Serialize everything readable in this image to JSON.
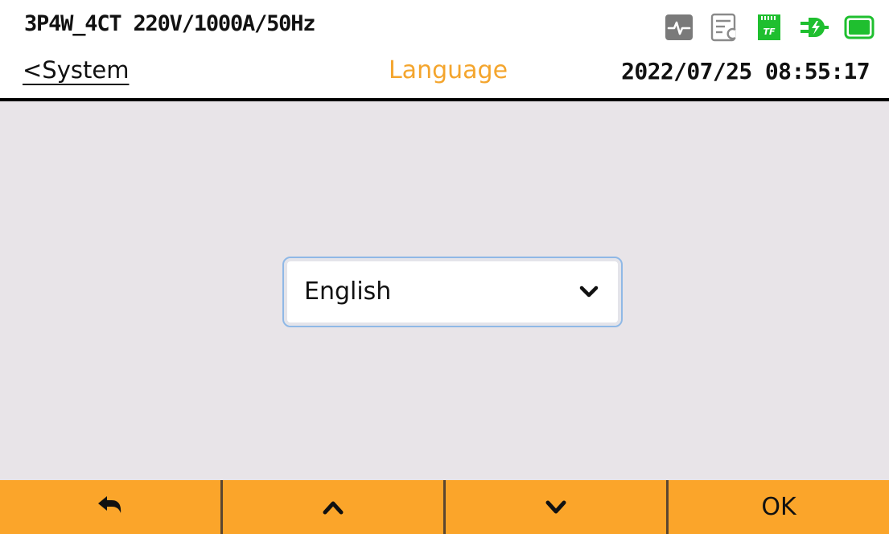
{
  "header": {
    "config": "3P4W_4CT 220V/1000A/50Hz",
    "back_label": "<System",
    "title": "Language",
    "datetime": "2022/07/25 08:55:17",
    "status_icons": [
      "waveform-icon",
      "log-icon",
      "sd-card-icon",
      "power-plug-icon",
      "battery-icon"
    ],
    "sd_card_text": "TF"
  },
  "language_select": {
    "value": "English"
  },
  "softkeys": [
    {
      "name": "back-return-icon",
      "label": ""
    },
    {
      "name": "up-arrow-icon",
      "label": ""
    },
    {
      "name": "down-arrow-icon",
      "label": ""
    },
    {
      "name": "ok",
      "label": "OK"
    }
  ],
  "colors": {
    "accent": "#fba52a",
    "title": "#f4a52d",
    "status_green": "#1fbf2f",
    "status_gray": "#7a7a7a",
    "select_border": "#8fb8e6",
    "background": "#e8e4e8"
  }
}
